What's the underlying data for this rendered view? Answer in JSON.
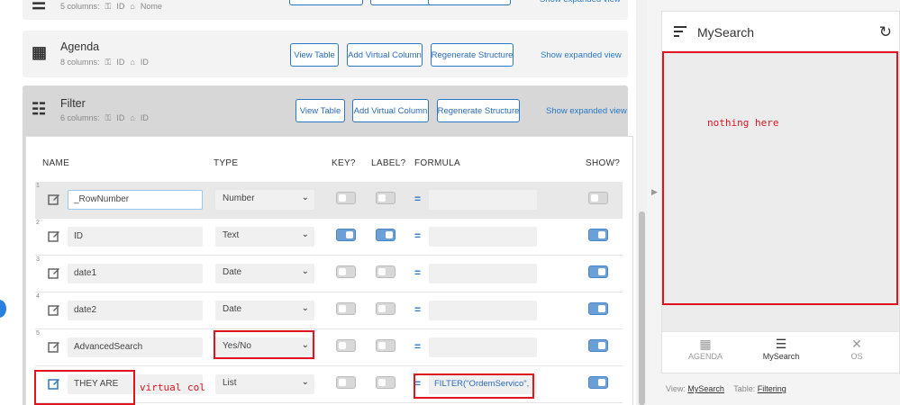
{
  "tables": [
    {
      "icon": "list-icon",
      "name": "",
      "columns": "5 columns:",
      "key": "ID",
      "label": "Nome"
    },
    {
      "icon": "calendar-icon",
      "name": "Agenda",
      "columns": "8 columns:",
      "key": "ID",
      "label": "ID"
    },
    {
      "icon": "filter-list-icon",
      "name": "Filter",
      "columns": "6 columns:",
      "key": "ID",
      "label": "ID"
    }
  ],
  "buttons": {
    "view_table": "View Table",
    "add_virtual": "Add Virtual Column",
    "regenerate": "Regenerate Structure",
    "expanded": "Show expanded view"
  },
  "grid": {
    "headers": {
      "name": "NAME",
      "type": "TYPE",
      "key": "KEY?",
      "label": "LABEL?",
      "formula": "FORMULA",
      "show": "SHOW?"
    },
    "rows": [
      {
        "num": "1",
        "name": "_RowNumber",
        "type": "Number",
        "key": false,
        "label": false,
        "formula": "",
        "show": false
      },
      {
        "num": "2",
        "name": "ID",
        "type": "Text",
        "key": true,
        "label": true,
        "formula": "",
        "show": true
      },
      {
        "num": "3",
        "name": "date1",
        "type": "Date",
        "key": false,
        "label": false,
        "formula": "",
        "show": true
      },
      {
        "num": "4",
        "name": "date2",
        "type": "Date",
        "key": false,
        "label": false,
        "formula": "",
        "show": true
      },
      {
        "num": "5",
        "name": "AdvancedSearch",
        "type": "Yes/No",
        "key": false,
        "label": false,
        "formula": "",
        "show": true
      },
      {
        "num": "",
        "name": "THEY ARE",
        "type": "List",
        "key": false,
        "label": false,
        "formula": "FILTER(\"OrdemServico\",",
        "show": true
      }
    ]
  },
  "annotations": {
    "virtual_col": "virtual col",
    "nothing_here": "nothing here"
  },
  "preview": {
    "app_title": "MySearch",
    "nav": [
      {
        "icon": "calendar-icon",
        "label": "AGENDA"
      },
      {
        "icon": "list-icon",
        "label": "MySearch"
      },
      {
        "icon": "tools-icon",
        "label": "OS"
      }
    ],
    "footer": {
      "view_label": "View:",
      "view_value": "MySearch",
      "table_label": "Table:",
      "table_value": "Filtering"
    }
  },
  "colors": {
    "accent": "#2a78c8",
    "annotation": "#e0141e",
    "toggle_on": "#6a9fd8"
  }
}
